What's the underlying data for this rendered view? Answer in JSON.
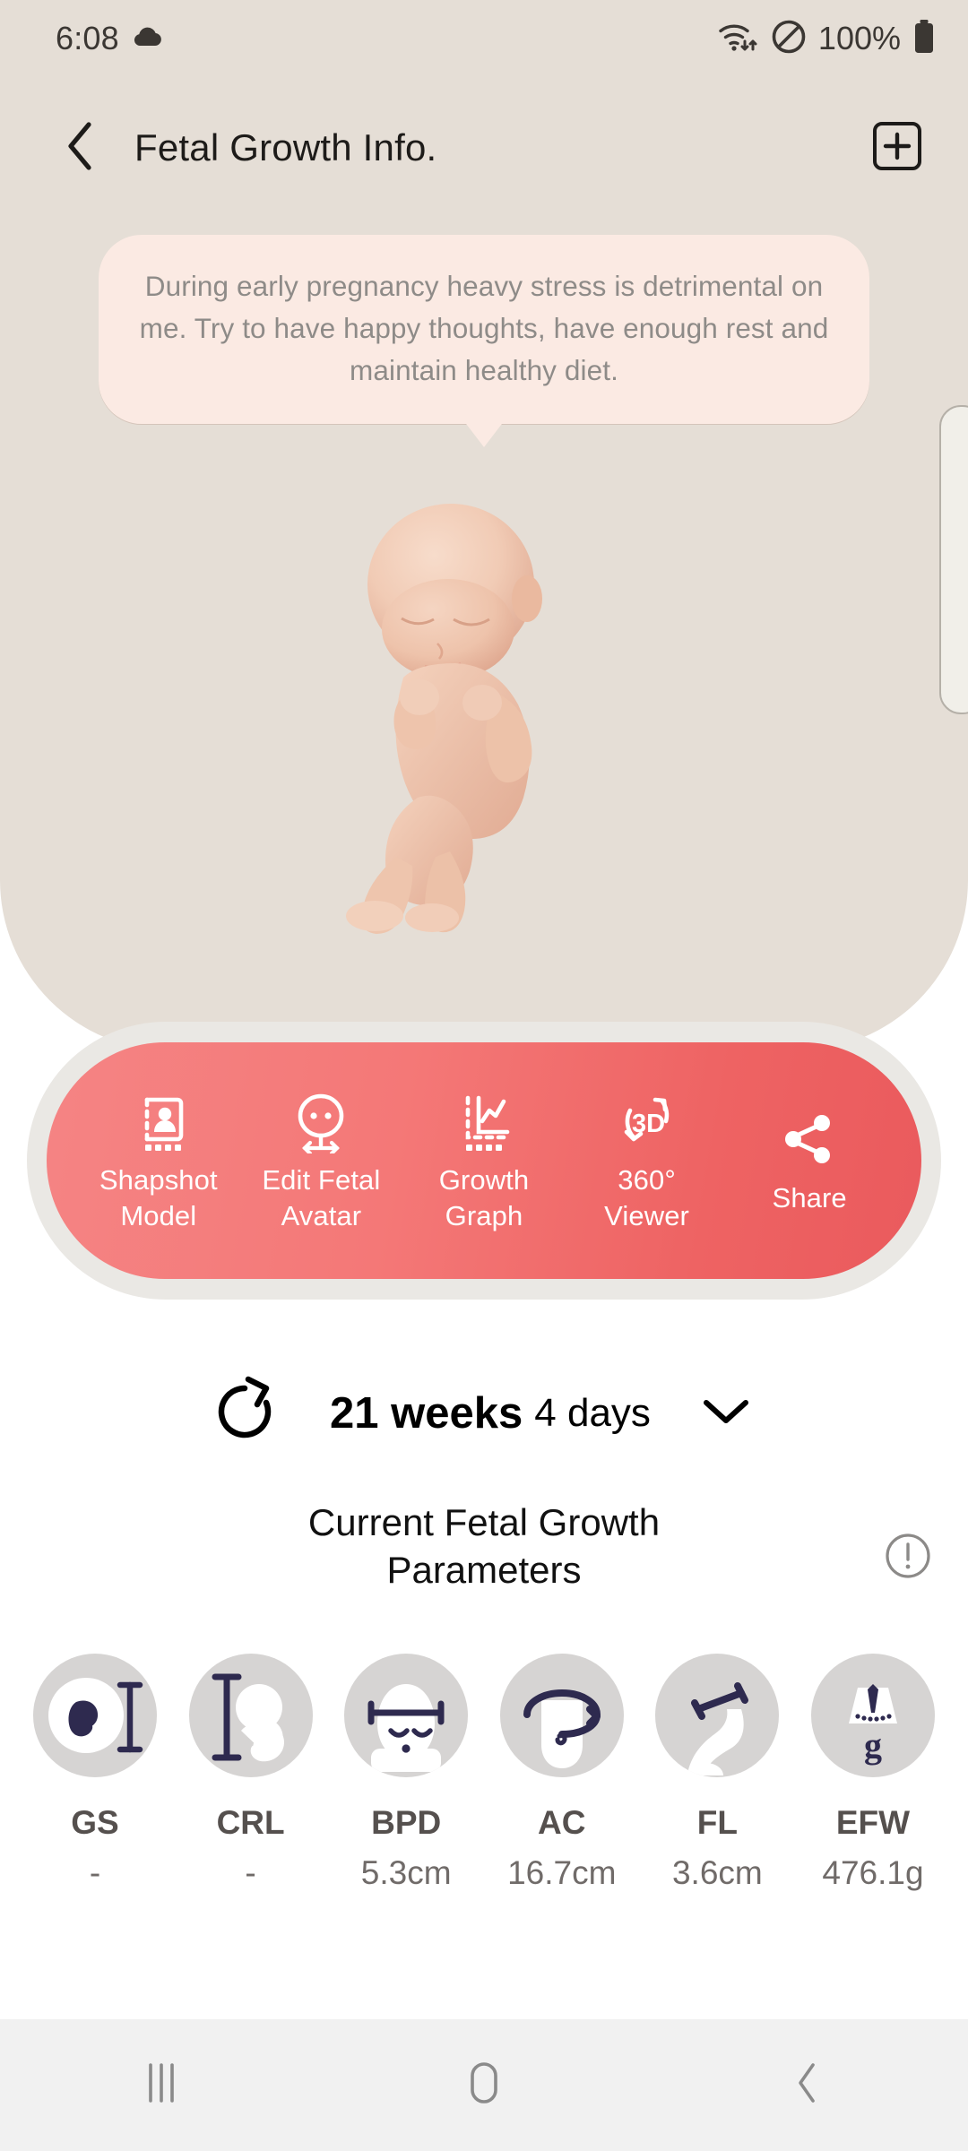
{
  "status_bar": {
    "time": "6:08",
    "cloud_icon": "cloud-icon",
    "wifi_icon": "wifi-transfer-icon",
    "dnd_icon": "do-not-disturb-icon",
    "battery_percent": "100%",
    "battery_icon": "battery-full-icon"
  },
  "header": {
    "back_icon": "chevron-left-icon",
    "title": "Fetal Growth Info.",
    "add_icon": "add-plus-box-icon"
  },
  "bubble": {
    "message": "During early pregnancy heavy stress is detrimental on me. Try to have happy thoughts, have enough rest and maintain healthy diet.",
    "background": "#fbeae3",
    "text_color": "#8e8b88"
  },
  "model": {
    "name": "fetal-3d-model",
    "skin_color": "#f0cbb6"
  },
  "action_bar": {
    "gradient_from": "#f58484",
    "gradient_to": "#ea5a5d",
    "items": [
      {
        "icon": "snapshot-model-icon",
        "label": "Shapshot\nModel",
        "line1": "Shapshot",
        "line2": "Model"
      },
      {
        "icon": "edit-fetal-avatar-icon",
        "label": "Edit Fetal\nAvatar",
        "line1": "Edit Fetal",
        "line2": "Avatar"
      },
      {
        "icon": "growth-graph-icon",
        "label": "Growth\nGraph",
        "line1": "Growth",
        "line2": "Graph"
      },
      {
        "icon": "360-viewer-icon",
        "label": "360°\nViewer",
        "line1": "360°",
        "line2": "Viewer"
      },
      {
        "icon": "share-icon",
        "label": "Share",
        "line1": "Share",
        "line2": ""
      }
    ]
  },
  "week_selector": {
    "refresh_icon": "refresh-icon",
    "weeks": "21 weeks",
    "days": "4 days",
    "chevron_icon": "chevron-down-icon"
  },
  "section": {
    "title_line1": "Current Fetal Growth",
    "title_line2": "Parameters",
    "info_icon": "info-exclamation-icon"
  },
  "parameters": {
    "circle_color": "#d6d4d3",
    "glyph_color": "#2e2a4f",
    "items": [
      {
        "icon": "gestational-sac-icon",
        "name": "GS",
        "value": "-"
      },
      {
        "icon": "crown-rump-length-icon",
        "name": "CRL",
        "value": "-"
      },
      {
        "icon": "biparietal-diameter-icon",
        "name": "BPD",
        "value": "5.3cm"
      },
      {
        "icon": "abdominal-circumference-icon",
        "name": "AC",
        "value": "16.7cm"
      },
      {
        "icon": "femur-length-icon",
        "name": "FL",
        "value": "3.6cm"
      },
      {
        "icon": "estimated-fetal-weight-icon",
        "name": "EFW",
        "value": "476.1g"
      }
    ]
  },
  "nav_bar": {
    "recents_icon": "recents-icon",
    "home_icon": "home-icon",
    "back_icon": "back-icon"
  }
}
